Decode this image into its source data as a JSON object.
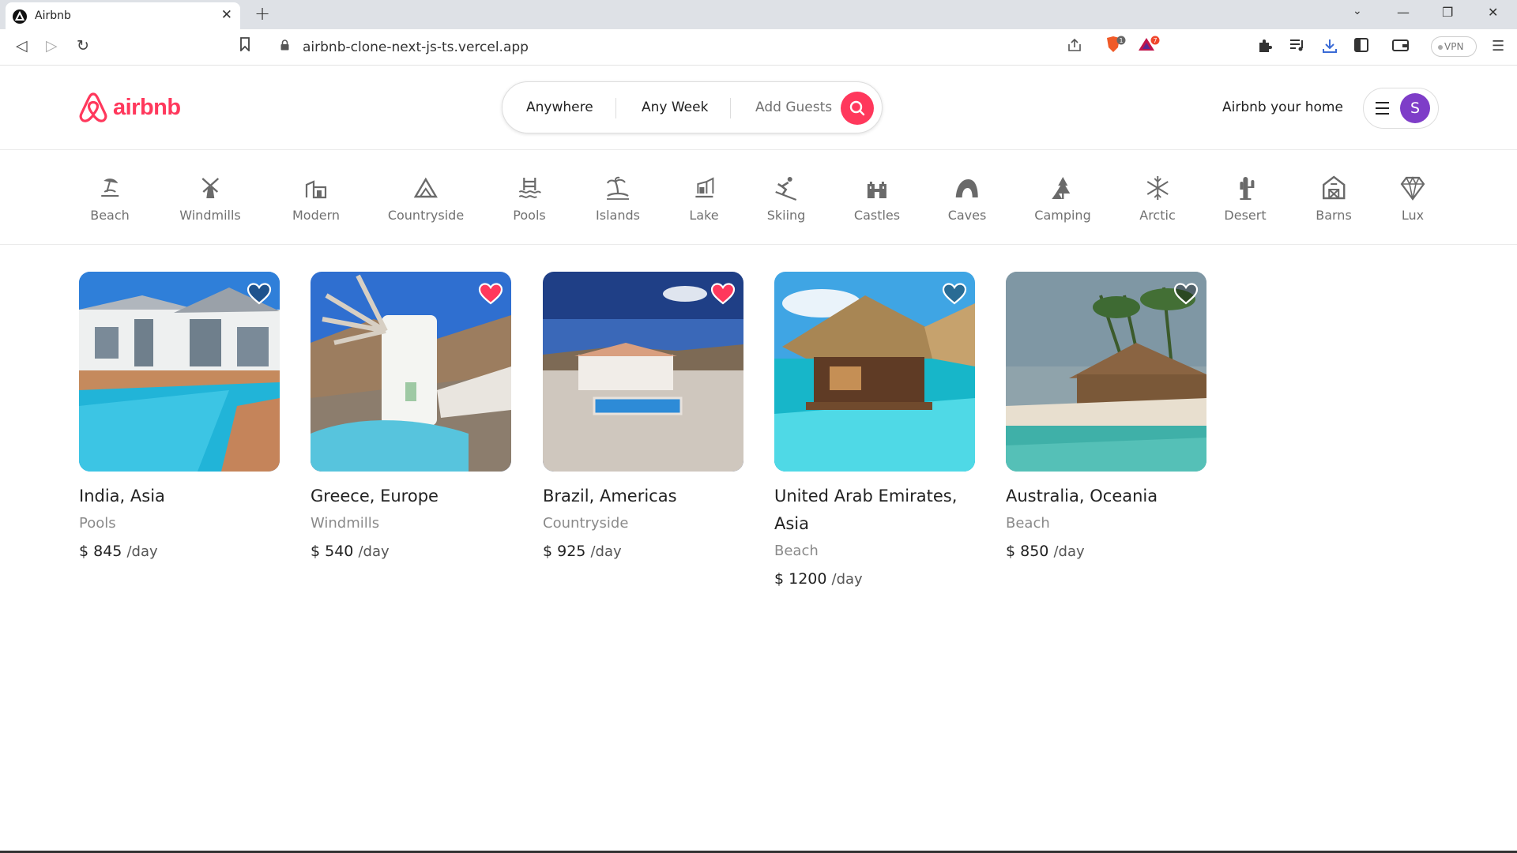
{
  "browser": {
    "tab_title": "Airbnb",
    "url": "airbnb-clone-next-js-ts.vercel.app",
    "vpn_label": "VPN",
    "shield_badge": "1",
    "rewards_badge": "7"
  },
  "header": {
    "logo_text": "airbnb",
    "search": {
      "where": "Anywhere",
      "when": "Any Week",
      "guests": "Add Guests"
    },
    "host_link": "Airbnb your home",
    "avatar_initial": "S"
  },
  "categories": [
    {
      "label": "Beach",
      "icon": "beach-icon"
    },
    {
      "label": "Windmills",
      "icon": "windmill-icon"
    },
    {
      "label": "Modern",
      "icon": "modern-house-icon"
    },
    {
      "label": "Countryside",
      "icon": "mountain-icon"
    },
    {
      "label": "Pools",
      "icon": "pool-icon"
    },
    {
      "label": "Islands",
      "icon": "island-icon"
    },
    {
      "label": "Lake",
      "icon": "lake-icon"
    },
    {
      "label": "Skiing",
      "icon": "skiing-icon"
    },
    {
      "label": "Castles",
      "icon": "castle-icon"
    },
    {
      "label": "Caves",
      "icon": "cave-icon"
    },
    {
      "label": "Camping",
      "icon": "camping-icon"
    },
    {
      "label": "Arctic",
      "icon": "snowflake-icon"
    },
    {
      "label": "Desert",
      "icon": "cactus-icon"
    },
    {
      "label": "Barns",
      "icon": "barn-icon"
    },
    {
      "label": "Lux",
      "icon": "diamond-icon"
    }
  ],
  "listings": [
    {
      "title": "India, Asia",
      "category": "Pools",
      "price": "$ 845",
      "per": "/day",
      "favorited": false
    },
    {
      "title": "Greece, Europe",
      "category": "Windmills",
      "price": "$ 540",
      "per": "/day",
      "favorited": true
    },
    {
      "title": "Brazil, Americas",
      "category": "Countryside",
      "price": "$ 925",
      "per": "/day",
      "favorited": true
    },
    {
      "title": "United Arab Emirates, Asia",
      "category": "Beach",
      "price": "$ 1200",
      "per": "/day",
      "favorited": false
    },
    {
      "title": "Australia, Oceania",
      "category": "Beach",
      "price": "$ 850",
      "per": "/day",
      "favorited": false
    }
  ],
  "colors": {
    "brand": "#ff385c",
    "avatar": "#7e3dc8",
    "muted_text": "#717171"
  }
}
